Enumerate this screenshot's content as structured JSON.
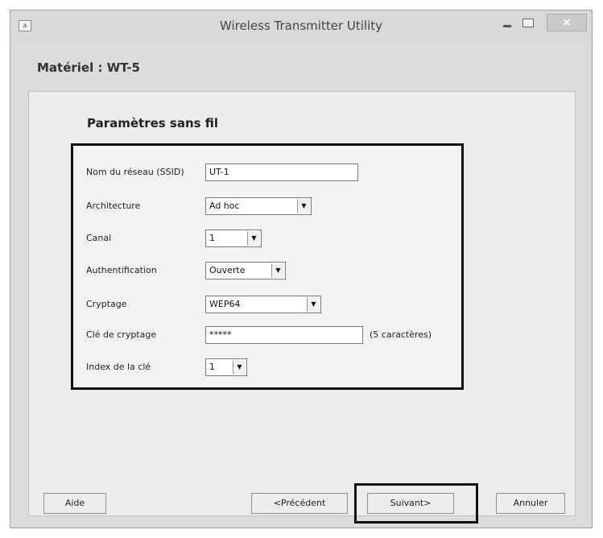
{
  "window": {
    "title": "Wireless Transmitter Utility",
    "close_symbol": "×"
  },
  "hardware_label": "Matériel : WT-5",
  "section_title": "Paramètres sans fil",
  "fields": {
    "ssid": {
      "label": "Nom du réseau (SSID)",
      "value": "UT-1"
    },
    "architecture": {
      "label": "Architecture",
      "value": "Ad hoc"
    },
    "channel": {
      "label": "Canal",
      "value": "1"
    },
    "authentication": {
      "label": "Authentification",
      "value": "Ouverte"
    },
    "encryption": {
      "label": "Cryptage",
      "value": "WEP64"
    },
    "key": {
      "label": "Clé de cryptage",
      "value": "*****",
      "hint": "(5 caractères)"
    },
    "key_index": {
      "label": "Index de la clé",
      "value": "1"
    }
  },
  "buttons": {
    "help": "Aide",
    "previous": "<Précédent",
    "next": "Suivant>",
    "cancel": "Annuler"
  },
  "icons": {
    "dropdown": "▼",
    "app": "app-icon"
  }
}
